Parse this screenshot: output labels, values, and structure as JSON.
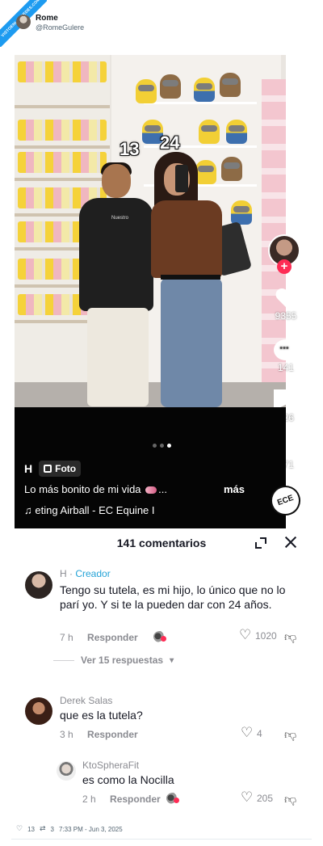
{
  "tweet": {
    "badge_text": "VISTOENLASREDES.COM",
    "name": "Rome",
    "handle": "@RomeGulere",
    "footer": {
      "likes": "13",
      "retweets": "3",
      "timestamp": "7:33 PM - Jun 3, 2025"
    }
  },
  "photo": {
    "overlay_left": "13",
    "overlay_right": "24",
    "shirt_text": "Nuestro"
  },
  "tiktok": {
    "author": "H",
    "post_type": "Foto",
    "caption": "Lo más bonito de mi vida",
    "caption_suffix": "...",
    "more_label": "más",
    "music": "♫ eting Airball - EC Equine I",
    "disc_label": "ECE",
    "carousel": {
      "total": 3,
      "active": 3
    },
    "actions": {
      "likes": "9355",
      "comments": "141",
      "saves": "326",
      "shares": "371"
    }
  },
  "comments_panel": {
    "title": "141 comentarios",
    "comments": [
      {
        "user": "H",
        "separator": " · ",
        "badge": "Creador",
        "text": "Tengo su tutela, es mi hijo, lo único que no lo parí yo. Y si te la pueden dar con 24 años.",
        "time": "7 h",
        "reply_label": "Responder",
        "likes": "1020"
      },
      {
        "user": "Derek Salas",
        "text": "que es la tutela?",
        "time": "3 h",
        "reply_label": "Responder",
        "likes": "4"
      },
      {
        "user": "KtoSpheraFit",
        "text": "es como la Nocilla",
        "time": "2 h",
        "reply_label": "Responder",
        "likes": "205"
      }
    ],
    "view_replies": "Ver 15 respuestas"
  },
  "colors": {
    "tiktok_red": "#fe2c55",
    "creator_blue": "#25a3d7",
    "twitter_blue": "#1d9bf0"
  },
  "icons": [
    "expand-icon",
    "close-icon",
    "heart-icon",
    "comment-icon",
    "bookmark-icon",
    "share-icon",
    "dislike-icon",
    "retweet-icon"
  ]
}
